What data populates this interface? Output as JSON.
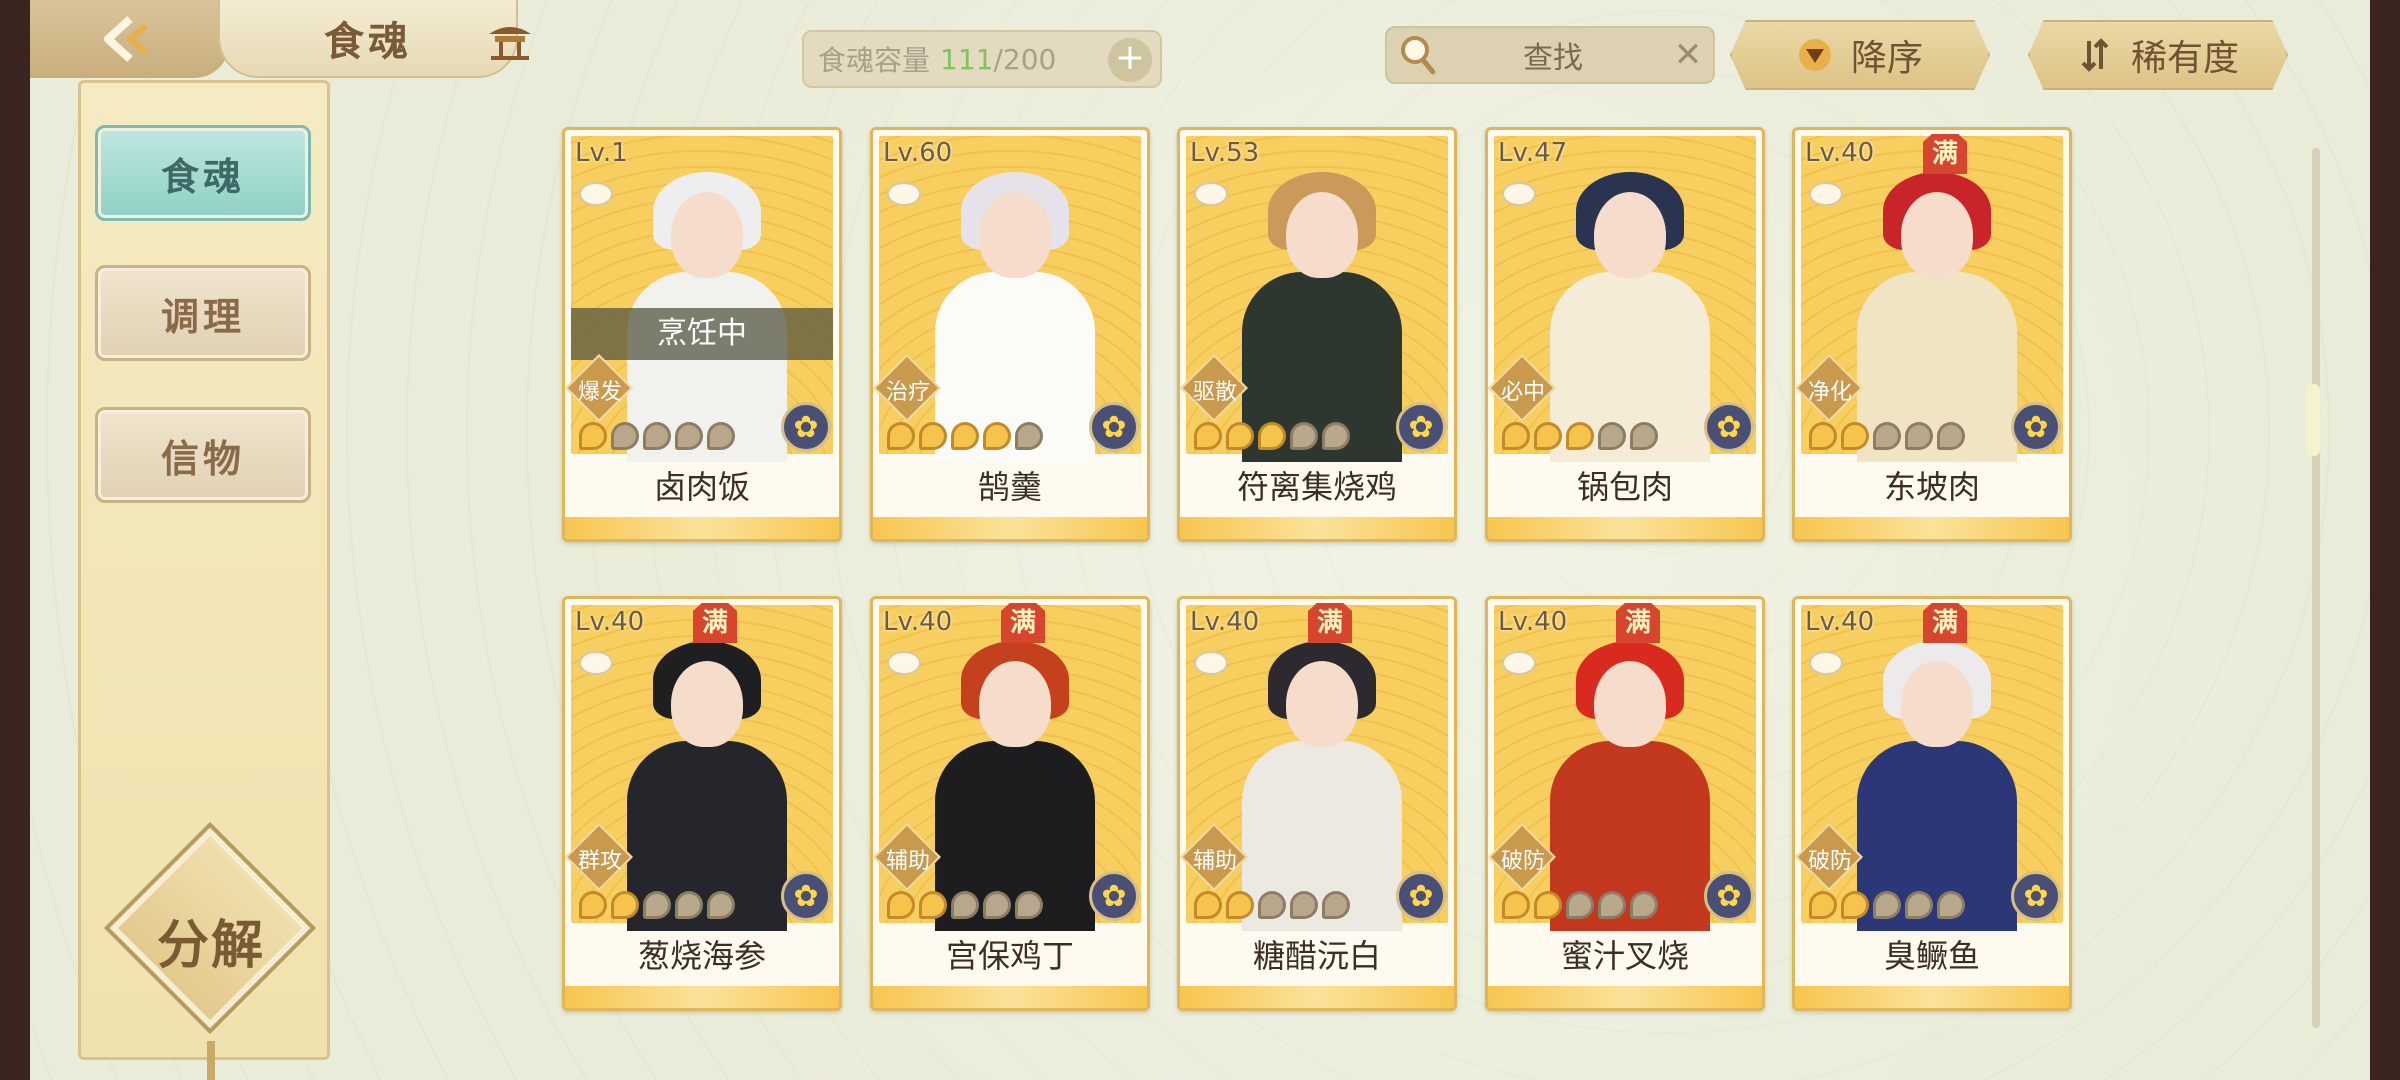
{
  "header": {
    "title": "食魂",
    "capacity_label": "食魂容量",
    "capacity_current": "111",
    "capacity_total": "/200",
    "capacity_add": "+",
    "search_label": "查找",
    "search_clear": "✕",
    "sort_order_label": "降序",
    "sort_key_label": "稀有度"
  },
  "sidebar": {
    "tabs": [
      {
        "label": "食魂",
        "active": true
      },
      {
        "label": "调理",
        "active": false
      },
      {
        "label": "信物",
        "active": false
      }
    ],
    "dismantle_label": "分解"
  },
  "cards": [
    {
      "level": "Lv.1",
      "max": "",
      "role": "爆发",
      "name": "卤肉饭",
      "stars": 5,
      "lit": 1,
      "status": "烹饪中",
      "hair": "#eeeeee",
      "outfit": "#f1f1ee"
    },
    {
      "level": "Lv.60",
      "max": "",
      "role": "治疗",
      "name": "鹄羹",
      "stars": 5,
      "lit": 4,
      "status": "",
      "hair": "#e6e2ea",
      "outfit": "#fbfbf8"
    },
    {
      "level": "Lv.53",
      "max": "",
      "role": "驱散",
      "name": "符离集烧鸡",
      "stars": 5,
      "lit": 3,
      "status": "",
      "hair": "#c99a5a",
      "outfit": "#2e3630"
    },
    {
      "level": "Lv.47",
      "max": "",
      "role": "必中",
      "name": "锅包肉",
      "stars": 5,
      "lit": 3,
      "status": "",
      "hair": "#2a3350",
      "outfit": "#f4ecd6"
    },
    {
      "level": "Lv.40",
      "max": "满",
      "role": "净化",
      "name": "东坡肉",
      "stars": 5,
      "lit": 2,
      "status": "",
      "hair": "#c8252a",
      "outfit": "#f1e4c2"
    },
    {
      "level": "Lv.40",
      "max": "满",
      "role": "群攻",
      "name": "葱烧海参",
      "stars": 5,
      "lit": 2,
      "status": "",
      "hair": "#1f1f22",
      "outfit": "#24262c"
    },
    {
      "level": "Lv.40",
      "max": "满",
      "role": "辅助",
      "name": "宫保鸡丁",
      "stars": 5,
      "lit": 2,
      "status": "",
      "hair": "#c5401c",
      "outfit": "#1d1d20"
    },
    {
      "level": "Lv.40",
      "max": "满",
      "role": "辅助",
      "name": "糖醋沅白",
      "stars": 5,
      "lit": 2,
      "status": "",
      "hair": "#2c2a2e",
      "outfit": "#ece9e2"
    },
    {
      "level": "Lv.40",
      "max": "满",
      "role": "破防",
      "name": "蜜汁叉烧",
      "stars": 5,
      "lit": 2,
      "status": "",
      "hair": "#d92a1f",
      "outfit": "#c23920"
    },
    {
      "level": "Lv.40",
      "max": "满",
      "role": "破防",
      "name": "臭鳜鱼",
      "stars": 5,
      "lit": 2,
      "status": "",
      "hair": "#eceaea",
      "outfit": "#2b3776"
    }
  ],
  "icons": {
    "back": "back-arrow-icon",
    "home": "pavilion-icon",
    "search": "magnifier-icon",
    "sort": "triangle-down-icon",
    "rarity": "sort-arrows-icon",
    "element": "flower-icon"
  },
  "colors": {
    "active_tab": "#8fd0c6",
    "card_border": "#e0b65a",
    "max_badge": "#d6452e"
  }
}
